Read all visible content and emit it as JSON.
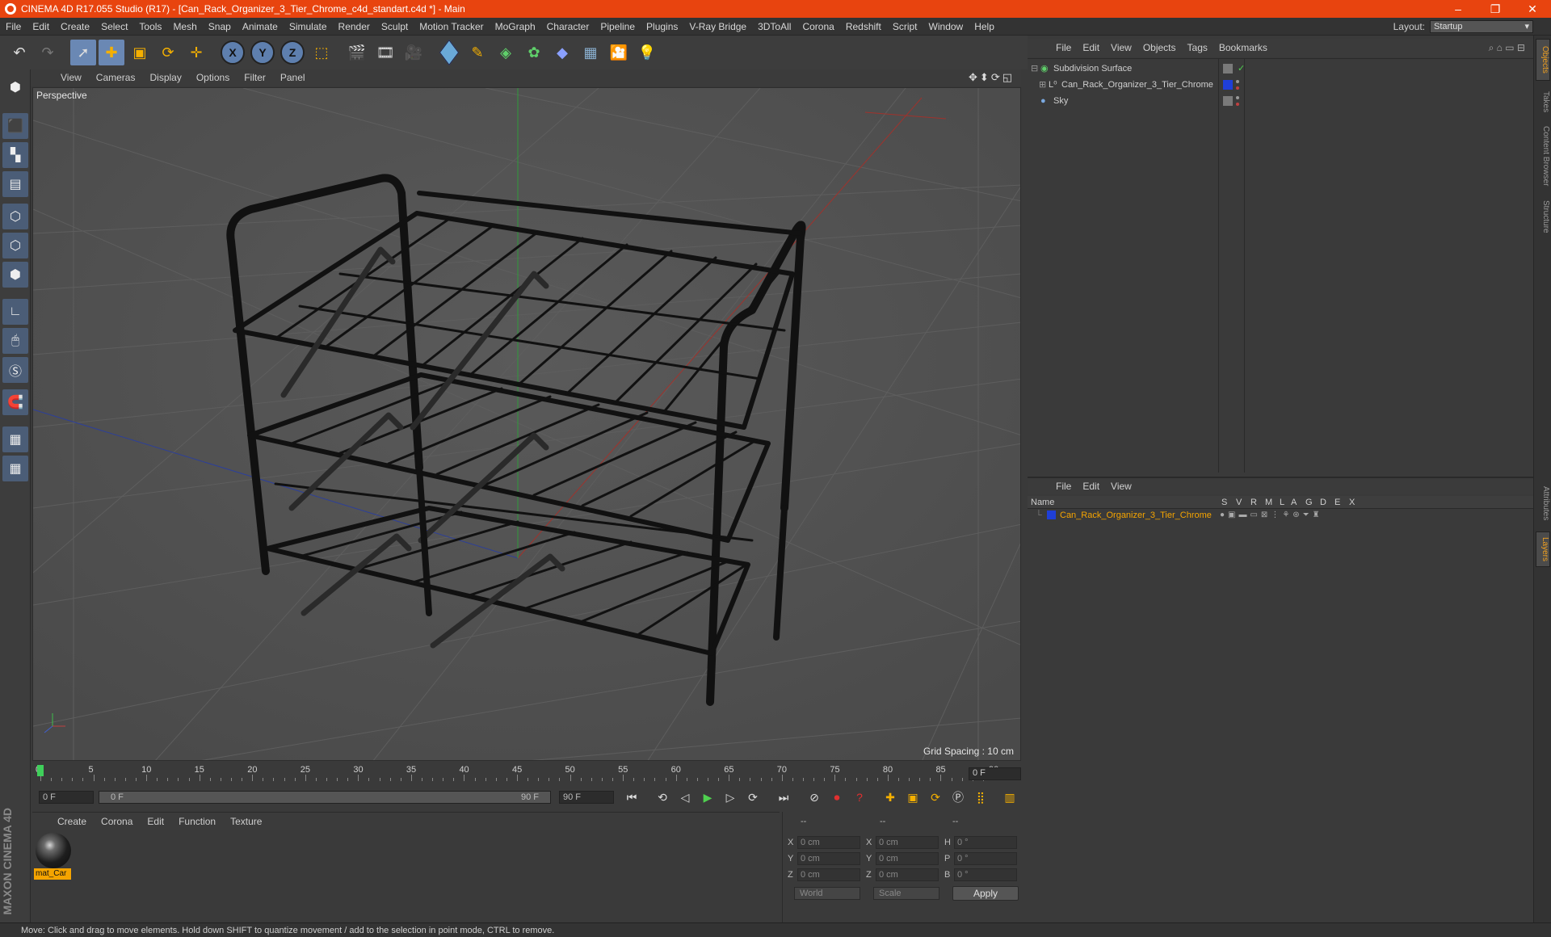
{
  "window": {
    "title": "CINEMA 4D R17.055 Studio (R17) - [Can_Rack_Organizer_3_Tier_Chrome_c4d_standart.c4d *] - Main",
    "controls": [
      "–",
      "❐",
      "✕"
    ]
  },
  "menubar": {
    "items": [
      "File",
      "Edit",
      "Create",
      "Select",
      "Tools",
      "Mesh",
      "Snap",
      "Animate",
      "Simulate",
      "Render",
      "Sculpt",
      "Motion Tracker",
      "MoGraph",
      "Character",
      "Pipeline",
      "Plugins",
      "V-Ray Bridge",
      "3DToAll",
      "Corona",
      "Redshift",
      "Script",
      "Window",
      "Help"
    ],
    "layout_label": "Layout:",
    "layout_value": "Startup"
  },
  "toolbar": {
    "axis_x": "X",
    "axis_y": "Y",
    "axis_z": "Z"
  },
  "viewport": {
    "menu": [
      "View",
      "Cameras",
      "Display",
      "Options",
      "Filter",
      "Panel"
    ],
    "label": "Perspective",
    "grid_spacing": "Grid Spacing : 10 cm",
    "nav_icons": "✥⬍⟳◱"
  },
  "timeline": {
    "ticks": [
      "0",
      "5",
      "10",
      "15",
      "20",
      "25",
      "30",
      "35",
      "40",
      "45",
      "50",
      "55",
      "60",
      "65",
      "70",
      "75",
      "80",
      "85",
      "90"
    ],
    "current_frame": "0 F",
    "start_field": "0 F",
    "range_start": "0 F",
    "range_end": "90 F",
    "end_field": "90 F",
    "frame_readout": "0 F"
  },
  "material_manager": {
    "menu": [
      "Create",
      "Corona",
      "Edit",
      "Function",
      "Texture"
    ],
    "material_name": "mat_Car"
  },
  "coordinates": {
    "header": [
      "--",
      "--",
      "--"
    ],
    "rows": [
      {
        "a": "X",
        "av": "0 cm",
        "b": "X",
        "bv": "0 cm",
        "c": "H",
        "cv": "0 °"
      },
      {
        "a": "Y",
        "av": "0 cm",
        "b": "Y",
        "bv": "0 cm",
        "c": "P",
        "cv": "0 °"
      },
      {
        "a": "Z",
        "av": "0 cm",
        "b": "Z",
        "bv": "0 cm",
        "c": "B",
        "cv": "0 °"
      }
    ],
    "mode_world": "World",
    "mode_scale": "Scale",
    "apply": "Apply"
  },
  "object_manager": {
    "menu": [
      "File",
      "Edit",
      "View",
      "Objects",
      "Tags",
      "Bookmarks"
    ],
    "objects": [
      {
        "name": "Subdivision Surface",
        "tag_color": "#7a7a7a",
        "check": "✓"
      },
      {
        "name": "Can_Rack_Organizer_3_Tier_Chrome",
        "tag_color": "#1f3fd8",
        "check": ""
      },
      {
        "name": "Sky",
        "tag_color": "#7a7a7a",
        "check": ""
      }
    ]
  },
  "layer_manager": {
    "menu": [
      "File",
      "Edit",
      "View"
    ],
    "columns": [
      "Name",
      "S",
      "V",
      "R",
      "M",
      "L",
      "A",
      "G",
      "D",
      "E",
      "X"
    ],
    "layers": [
      {
        "name": "Can_Rack_Organizer_3_Tier_Chrome",
        "color": "#1f3fd8"
      }
    ]
  },
  "right_tabs": [
    "Objects",
    "Takes",
    "Content Browser",
    "Structure",
    "Attributes",
    "Layers"
  ],
  "status": "Move: Click and drag to move elements. Hold down SHIFT to quantize movement / add to the selection in point mode, CTRL to remove.",
  "brand": "MAXON CINEMA 4D",
  "colors": {
    "accent": "#e8440f",
    "selection": "#f5a400",
    "layer_blue": "#1f3fd8"
  }
}
